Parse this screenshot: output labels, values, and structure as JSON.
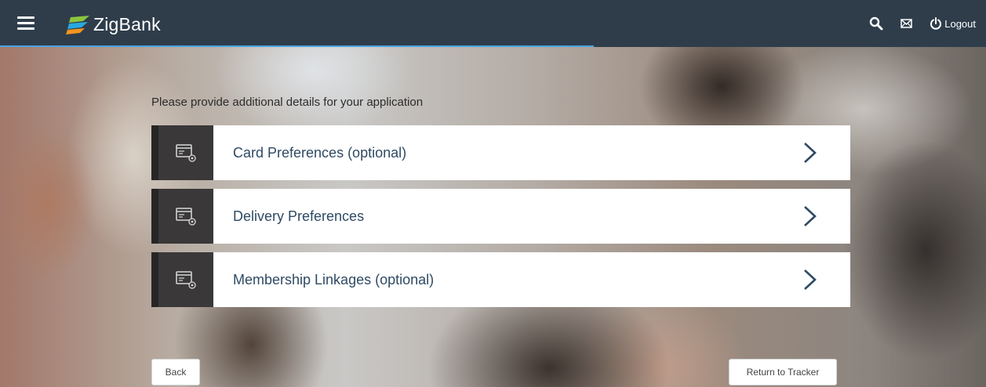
{
  "app": {
    "brand": "ZigBank"
  },
  "header": {
    "menu_icon": "hamburger-menu-icon",
    "search_icon": "search-icon",
    "mail_icon": "mail-icon",
    "logout_icon": "power-icon",
    "logout_label": "Logout"
  },
  "main": {
    "prompt": "Please provide additional details for your application",
    "options": [
      {
        "label": "Card Preferences (optional)",
        "icon": "card-settings-icon"
      },
      {
        "label": "Delivery Preferences",
        "icon": "card-settings-icon"
      },
      {
        "label": "Membership Linkages (optional)",
        "icon": "card-settings-icon"
      }
    ]
  },
  "footer": {
    "back_label": "Back",
    "tracker_label": "Return to Tracker"
  },
  "colors": {
    "header_bg": "#2f3d4b",
    "accent": "#4aa3df",
    "option_label": "#2f4a64",
    "icon_panel": "#3a3838"
  }
}
